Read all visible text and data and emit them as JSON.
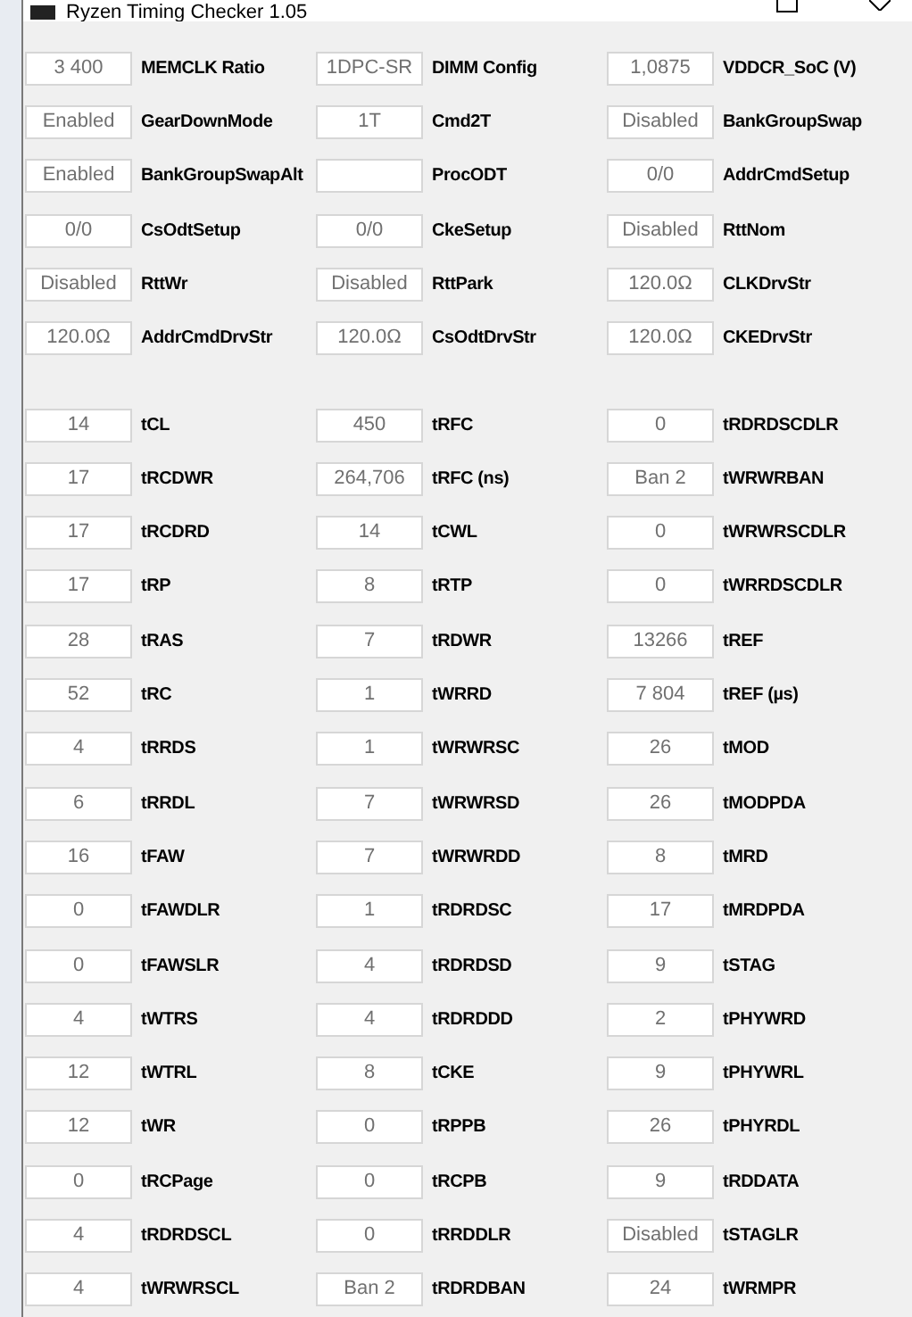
{
  "window": {
    "title": "Ryzen Timing Checker 1.05"
  },
  "sections": [
    {
      "fields": [
        {
          "value": "3 400",
          "name": "MEMCLK Ratio"
        },
        {
          "value": "1DPC-SR",
          "name": "DIMM Config"
        },
        {
          "value": "1,0875",
          "name": "VDDCR_SoC (V)"
        },
        {
          "value": "Enabled",
          "name": "GearDownMode"
        },
        {
          "value": "1T",
          "name": "Cmd2T"
        },
        {
          "value": "Disabled",
          "name": "BankGroupSwap"
        },
        {
          "value": "Enabled",
          "name": "BankGroupSwapAlt"
        },
        {
          "name": "ProcODT"
        },
        {
          "value": "0/0",
          "name": "AddrCmdSetup"
        },
        {
          "value": "0/0",
          "name": "CsOdtSetup"
        },
        {
          "value": "0/0",
          "name": "CkeSetup"
        },
        {
          "value": "Disabled",
          "name": "RttNom"
        },
        {
          "value": "Disabled",
          "name": "RttWr"
        },
        {
          "value": "Disabled",
          "name": "RttPark"
        },
        {
          "value": "120.0Ω",
          "name": "CLKDrvStr"
        },
        {
          "value": "120.0Ω",
          "name": "AddrCmdDrvStr"
        },
        {
          "value": "120.0Ω",
          "name": "CsOdtDrvStr"
        },
        {
          "value": "120.0Ω",
          "name": "CKEDrvStr"
        }
      ]
    },
    {
      "fields": [
        {
          "value": "14",
          "name": "tCL"
        },
        {
          "value": "450",
          "name": "tRFC"
        },
        {
          "value": "0",
          "name": "tRDRDSCDLR"
        },
        {
          "value": "17",
          "name": "tRCDWR"
        },
        {
          "value": "264,706",
          "name": "tRFC (ns)"
        },
        {
          "value": "Ban 2",
          "name": "tWRWRBAN"
        },
        {
          "value": "17",
          "name": "tRCDRD"
        },
        {
          "value": "14",
          "name": "tCWL"
        },
        {
          "value": "0",
          "name": "tWRWRSCDLR"
        },
        {
          "value": "17",
          "name": "tRP"
        },
        {
          "value": "8",
          "name": "tRTP"
        },
        {
          "value": "0",
          "name": "tWRRDSCDLR"
        },
        {
          "value": "28",
          "name": "tRAS"
        },
        {
          "value": "7",
          "name": "tRDWR"
        },
        {
          "value": "13266",
          "name": "tREF"
        },
        {
          "value": "52",
          "name": "tRC"
        },
        {
          "value": "1",
          "name": "tWRRD"
        },
        {
          "value": "7 804",
          "name": "tREF (µs)"
        },
        {
          "value": "4",
          "name": "tRRDS"
        },
        {
          "value": "1",
          "name": "tWRWRSC"
        },
        {
          "value": "26",
          "name": "tMOD"
        },
        {
          "value": "6",
          "name": "tRRDL"
        },
        {
          "value": "7",
          "name": "tWRWRSD"
        },
        {
          "value": "26",
          "name": "tMODPDA"
        },
        {
          "value": "16",
          "name": "tFAW"
        },
        {
          "value": "7",
          "name": "tWRWRDD"
        },
        {
          "value": "8",
          "name": "tMRD"
        },
        {
          "value": "0",
          "name": "tFAWDLR"
        },
        {
          "value": "1",
          "name": "tRDRDSC"
        },
        {
          "value": "17",
          "name": "tMRDPDA"
        },
        {
          "value": "0",
          "name": "tFAWSLR"
        },
        {
          "value": "4",
          "name": "tRDRDSD"
        },
        {
          "value": "9",
          "name": "tSTAG"
        },
        {
          "value": "4",
          "name": "tWTRS"
        },
        {
          "value": "4",
          "name": "tRDRDDD"
        },
        {
          "value": "2",
          "name": "tPHYWRD"
        },
        {
          "value": "12",
          "name": "tWTRL"
        },
        {
          "value": "8",
          "name": "tCKE"
        },
        {
          "value": "9",
          "name": "tPHYWRL"
        },
        {
          "value": "12",
          "name": "tWR"
        },
        {
          "value": "0",
          "name": "tRPPB"
        },
        {
          "value": "26",
          "name": "tPHYRDL"
        },
        {
          "value": "0",
          "name": "tRCPage"
        },
        {
          "value": "0",
          "name": "tRCPB"
        },
        {
          "value": "9",
          "name": "tRDDATA"
        },
        {
          "value": "4",
          "name": "tRDRDSCL"
        },
        {
          "value": "0",
          "name": "tRRDDLR"
        },
        {
          "value": "Disabled",
          "name": "tSTAGLR"
        },
        {
          "value": "4",
          "name": "tWRWRSCL"
        },
        {
          "value": "Ban 2",
          "name": "tRDRDBAN"
        },
        {
          "value": "24",
          "name": "tWRMPR"
        }
      ]
    }
  ]
}
